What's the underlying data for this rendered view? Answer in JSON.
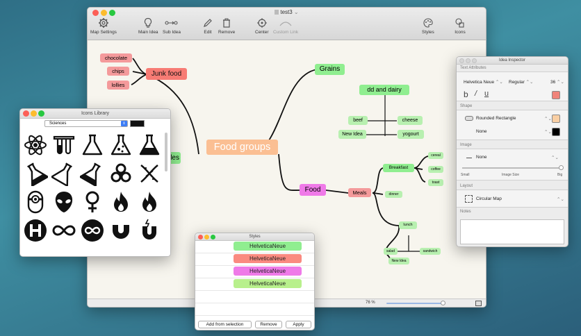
{
  "main_window": {
    "title": "test3",
    "toolbar": {
      "map_settings": "Map Settings",
      "main_idea": "Main Idea",
      "sub_idea": "Sub Idea",
      "edit": "Edit",
      "remove": "Remove",
      "center": "Center",
      "custom_link": "Custom Link",
      "styles": "Styles",
      "icons": "Icons"
    },
    "zoom": "76 %"
  },
  "mindmap": {
    "root": "Food groups",
    "junk_food": "Junk food",
    "chocolate": "chocolate",
    "chips": "chips",
    "lollies": "lollies",
    "grains": "Grains",
    "dairy": "dd and dairy",
    "beef": "beef",
    "cheese": "cheese",
    "new_idea": "New Idea",
    "yogourt": "yogourt",
    "partial_left": "bles",
    "food": "Food",
    "meals": "Meals",
    "breakfast": "Breakfast",
    "cereal": "cereal",
    "coffee": "coffee",
    "toast": "toast",
    "dinner": "dinner",
    "lunch": "lunch",
    "salad": "salad",
    "sandwich": "sandwich",
    "new_idea2": "New Idea"
  },
  "icons_library": {
    "title": "Icons Library",
    "category": "Sciences",
    "icons": [
      "atom-icon",
      "test-tubes-icon",
      "flask-icon",
      "flask-bubbles-icon",
      "flask-liquid-icon",
      "tilted-flask-icon",
      "tilted-flask-empty-icon",
      "tilted-flask-half-icon",
      "biohazard-icon",
      "dna-icon",
      "minion-icon",
      "alien-icon",
      "female-symbol-icon",
      "flame-icon",
      "flame-2-icon",
      "hospital-h-icon",
      "infinity-icon",
      "infinity-circle-icon",
      "magnet-icon",
      "magnet-spark-icon"
    ]
  },
  "inspector": {
    "title": "Idea Inspector",
    "text_attributes": "Text Attributes",
    "font": "Helvetica Neue",
    "weight": "Regular",
    "size": "36",
    "shape_label": "Shape",
    "shape": "Rounded Rectangle",
    "border": "None",
    "image_label": "Image",
    "image": "None",
    "small": "Small",
    "image_size": "Image Size",
    "big": "Big",
    "layout_label": "Layout",
    "layout": "Circular Map",
    "notes_label": "Notes",
    "fill_color": "#f0837a",
    "shape_fill": "#f9cfa4",
    "border_color": "#000000"
  },
  "styles_panel": {
    "title": "Styles",
    "items": [
      {
        "label": "HelveticaNeue",
        "color": "#90ee90"
      },
      {
        "label": "HelveticaNeue",
        "color": "#fa8a80"
      },
      {
        "label": "HelveticaNeue",
        "color": "#ef7ae8"
      },
      {
        "label": "HelveticaNeue",
        "color": "#b8f08c"
      }
    ],
    "add_from_selection": "Add from selection",
    "remove": "Remove",
    "apply": "Apply"
  }
}
